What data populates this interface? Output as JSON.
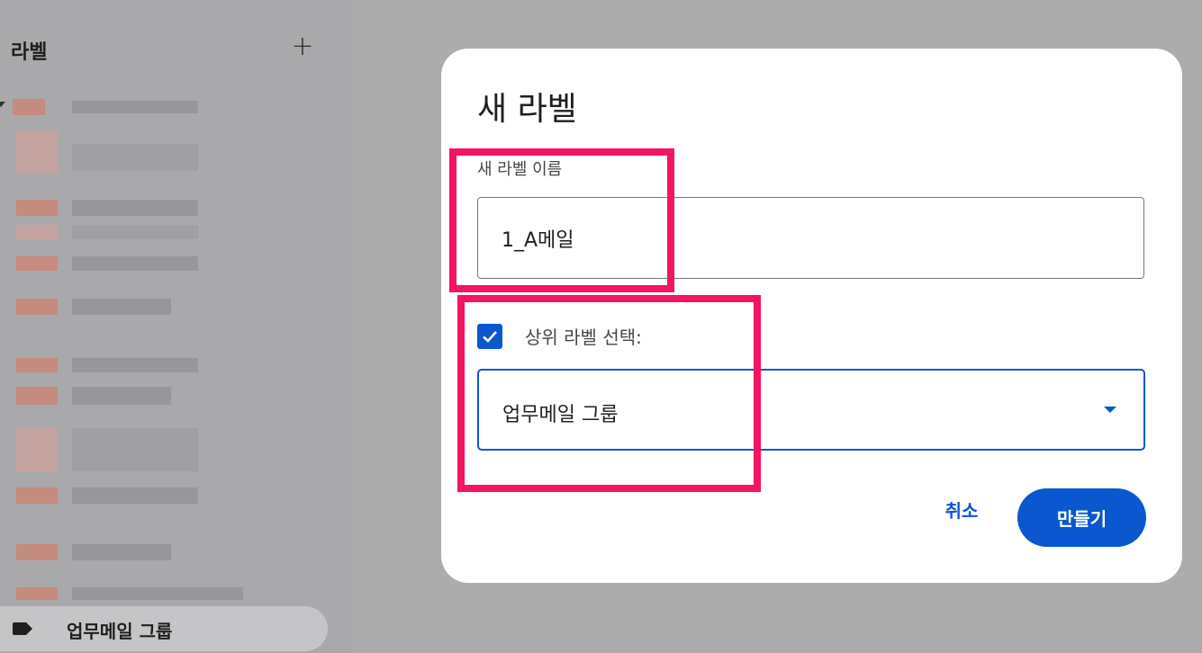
{
  "sidebar": {
    "title": "라벨",
    "add_icon": "plus-icon",
    "active_item": {
      "label": "업무메일 그룹",
      "icon": "label-tag-icon"
    }
  },
  "dialog": {
    "title": "새 라벨",
    "name_field": {
      "label": "새 라벨 이름",
      "value": "1_A메일"
    },
    "parent_checkbox": {
      "checked": true,
      "label": "상위 라벨 선택:"
    },
    "parent_select": {
      "value": "업무메일 그룹",
      "icon": "dropdown-arrow-icon"
    },
    "cancel_label": "취소",
    "create_label": "만들기"
  },
  "colors": {
    "accent": "#0b57d0",
    "annotation": "#f41461",
    "overlay": "#acacac"
  }
}
